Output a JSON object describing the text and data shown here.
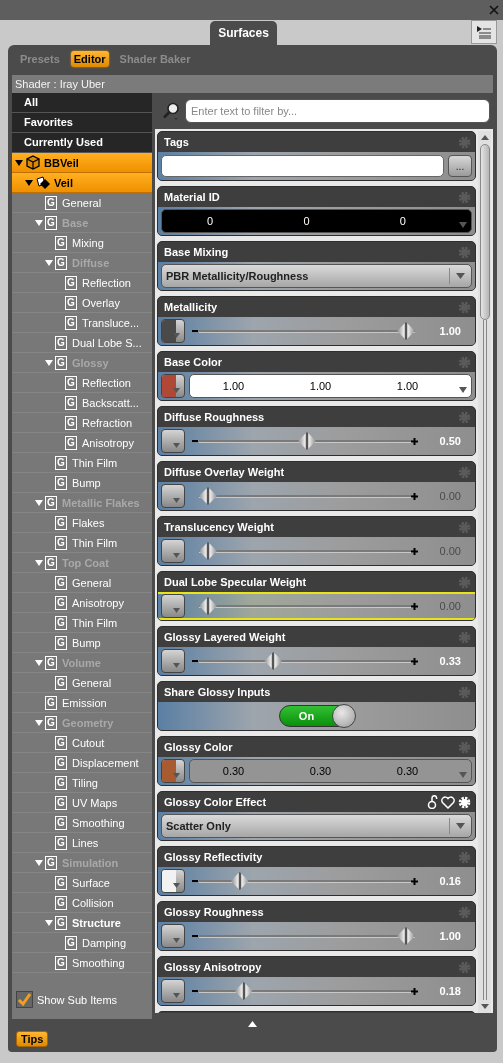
{
  "window": {
    "tab": "Surfaces"
  },
  "tabs": [
    {
      "label": "Presets",
      "selected": false
    },
    {
      "label": "Editor",
      "selected": true
    },
    {
      "label": "Shader Baker",
      "selected": false
    }
  ],
  "shader": "Shader : Iray Uber",
  "filters": [
    {
      "label": "All",
      "selected": false
    },
    {
      "label": "Favorites",
      "selected": false
    },
    {
      "label": "Currently Used",
      "selected": false
    }
  ],
  "tree": [
    {
      "label": "BBVeil",
      "kind": "figure",
      "selected": true,
      "expanded": true,
      "children": [
        {
          "label": "Veil",
          "kind": "surface",
          "selected": true,
          "expanded": true,
          "children": [
            {
              "label": "General",
              "kind": "group",
              "icon": "G",
              "selected": false
            },
            {
              "label": "Base",
              "kind": "group",
              "icon": "G",
              "selected": false,
              "expanded": true,
              "dimmed": true,
              "children": [
                {
                  "label": "Mixing",
                  "kind": "group",
                  "icon": "G",
                  "selected": false
                },
                {
                  "label": "Diffuse",
                  "kind": "group",
                  "icon": "G",
                  "selected": false,
                  "expanded": true,
                  "dimmed": true,
                  "children": [
                    {
                      "label": "Reflection",
                      "kind": "group",
                      "icon": "G",
                      "selected": false
                    },
                    {
                      "label": "Overlay",
                      "kind": "group",
                      "icon": "G",
                      "selected": false
                    },
                    {
                      "label": "Transluce...",
                      "kind": "group",
                      "icon": "G",
                      "selected": false
                    }
                  ]
                },
                {
                  "label": "Dual Lobe S...",
                  "kind": "group",
                  "icon": "G",
                  "selected": false
                },
                {
                  "label": "Glossy",
                  "kind": "group",
                  "icon": "G",
                  "selected": false,
                  "expanded": true,
                  "dimmed": true,
                  "children": [
                    {
                      "label": "Reflection",
                      "kind": "group",
                      "icon": "G",
                      "selected": false
                    },
                    {
                      "label": "Backscatt...",
                      "kind": "group",
                      "icon": "G",
                      "selected": false
                    },
                    {
                      "label": "Refraction",
                      "kind": "group",
                      "icon": "G",
                      "selected": false
                    },
                    {
                      "label": "Anisotropy",
                      "kind": "group",
                      "icon": "G",
                      "selected": false
                    }
                  ]
                },
                {
                  "label": "Thin Film",
                  "kind": "group",
                  "icon": "G",
                  "selected": false
                },
                {
                  "label": "Bump",
                  "kind": "group",
                  "icon": "G",
                  "selected": false
                }
              ]
            },
            {
              "label": "Metallic Flakes",
              "kind": "group",
              "icon": "G",
              "selected": false,
              "expanded": true,
              "dimmed": true,
              "children": [
                {
                  "label": "Flakes",
                  "kind": "group",
                  "icon": "G",
                  "selected": false
                },
                {
                  "label": "Thin Film",
                  "kind": "group",
                  "icon": "G",
                  "selected": false
                }
              ]
            },
            {
              "label": "Top Coat",
              "kind": "group",
              "icon": "G",
              "selected": false,
              "expanded": true,
              "dimmed": true,
              "children": [
                {
                  "label": "General",
                  "kind": "group",
                  "icon": "G",
                  "selected": false
                },
                {
                  "label": "Anisotropy",
                  "kind": "group",
                  "icon": "G",
                  "selected": false
                },
                {
                  "label": "Thin Film",
                  "kind": "group",
                  "icon": "G",
                  "selected": false
                },
                {
                  "label": "Bump",
                  "kind": "group",
                  "icon": "G",
                  "selected": false
                }
              ]
            },
            {
              "label": "Volume",
              "kind": "group",
              "icon": "G",
              "selected": false,
              "expanded": true,
              "dimmed": true,
              "children": [
                {
                  "label": "General",
                  "kind": "group",
                  "icon": "G",
                  "selected": false
                }
              ]
            },
            {
              "label": "Emission",
              "kind": "group",
              "icon": "G",
              "selected": false
            },
            {
              "label": "Geometry",
              "kind": "group",
              "icon": "G",
              "selected": false,
              "expanded": true,
              "dimmed": true,
              "children": [
                {
                  "label": "Cutout",
                  "kind": "group",
                  "icon": "G",
                  "selected": false
                },
                {
                  "label": "Displacement",
                  "kind": "group",
                  "icon": "G",
                  "selected": false
                },
                {
                  "label": "Tiling",
                  "kind": "group",
                  "icon": "G",
                  "selected": false
                },
                {
                  "label": "UV Maps",
                  "kind": "group",
                  "icon": "G",
                  "selected": false
                },
                {
                  "label": "Smoothing",
                  "kind": "group",
                  "icon": "G",
                  "selected": false
                },
                {
                  "label": "Lines",
                  "kind": "group",
                  "icon": "G",
                  "selected": false
                }
              ]
            },
            {
              "label": "Simulation",
              "kind": "group",
              "icon": "G",
              "selected": false,
              "expanded": true,
              "dimmed": true,
              "children": [
                {
                  "label": "Surface",
                  "kind": "group",
                  "icon": "G",
                  "selected": false
                },
                {
                  "label": "Collision",
                  "kind": "group",
                  "icon": "G",
                  "selected": false
                },
                {
                  "label": "Structure",
                  "kind": "group",
                  "icon": "G",
                  "selected": false,
                  "expanded": true,
                  "dimmed": false,
                  "children": [
                    {
                      "label": "Damping",
                      "kind": "group",
                      "icon": "G",
                      "selected": false
                    }
                  ]
                },
                {
                  "label": "Smoothing",
                  "kind": "group",
                  "icon": "G",
                  "selected": false
                }
              ]
            }
          ]
        }
      ]
    }
  ],
  "show_sub_items": {
    "label": "Show Sub Items",
    "checked": true
  },
  "search": {
    "placeholder": "Enter text to filter by..."
  },
  "properties": [
    {
      "kind": "text",
      "title": "Tags",
      "button": "...",
      "highlighted": false,
      "hovered": false
    },
    {
      "kind": "triplet",
      "title": "Material ID",
      "values": [
        "0",
        "0",
        "0"
      ],
      "highlighted": false,
      "hovered": false
    },
    {
      "kind": "dropdown",
      "title": "Base Mixing",
      "value": "PBR Metallicity/Roughness",
      "highlighted": false,
      "hovered": false
    },
    {
      "kind": "slider",
      "title": "Metallicity",
      "color": "#4a4a4a",
      "level": 1,
      "value": "1.00",
      "inactive": false,
      "highlighted": false,
      "hovered": false
    },
    {
      "kind": "triplet",
      "title": "Base Color",
      "color": "#b04838",
      "values": [
        "1.00",
        "1.00",
        "1.00"
      ],
      "highlighted": false,
      "hovered": false
    },
    {
      "kind": "slider",
      "title": "Diffuse Roughness",
      "level": 0.5,
      "value": "0.50",
      "inactive": false,
      "highlighted": false,
      "hovered": false
    },
    {
      "kind": "slider",
      "title": "Diffuse Overlay Weight",
      "level": 0,
      "value": "0.00",
      "inactive": true,
      "highlighted": false,
      "hovered": false
    },
    {
      "kind": "slider",
      "title": "Translucency Weight",
      "level": 0,
      "value": "0.00",
      "inactive": true,
      "highlighted": false,
      "hovered": false
    },
    {
      "kind": "slider",
      "title": "Dual Lobe Specular Weight",
      "level": 0,
      "value": "0.00",
      "inactive": true,
      "highlighted": true,
      "hovered": false
    },
    {
      "kind": "slider",
      "title": "Glossy Layered Weight",
      "level": 0.33,
      "value": "0.33",
      "inactive": false,
      "highlighted": false,
      "hovered": false
    },
    {
      "kind": "toggle",
      "title": "Share Glossy Inputs",
      "on": true,
      "label": "On",
      "highlighted": false,
      "hovered": false
    },
    {
      "kind": "triplet",
      "title": "Glossy Color",
      "color": "#a85a30",
      "values": [
        "0.30",
        "0.30",
        "0.30"
      ],
      "highlighted": false,
      "hovered": false
    },
    {
      "kind": "dropdown",
      "title": "Glossy Color Effect",
      "value": "Scatter Only",
      "highlighted": false,
      "hovered": true
    },
    {
      "kind": "slider",
      "title": "Glossy Reflectivity",
      "color": "#f2f2f2",
      "level": 0.16,
      "value": "0.16",
      "inactive": false,
      "highlighted": false,
      "hovered": false
    },
    {
      "kind": "slider",
      "title": "Glossy Roughness",
      "level": 1,
      "value": "1.00",
      "inactive": false,
      "highlighted": false,
      "hovered": false
    },
    {
      "kind": "slider",
      "title": "Glossy Anisotropy",
      "level": 0.18,
      "value": "0.18",
      "inactive": false,
      "highlighted": false,
      "hovered": false
    }
  ],
  "tips": "Tips"
}
